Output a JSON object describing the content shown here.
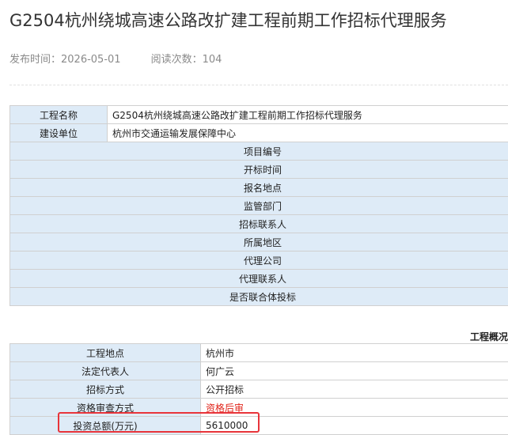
{
  "title": "G2504杭州绕城高速公路改扩建工程前期工作招标代理服务",
  "meta": {
    "publish_label": "发布时间：",
    "publish_date": "2026-05-01",
    "views_label": "阅读次数：",
    "views": "104"
  },
  "info_table": {
    "project_name_label": "工程名称",
    "project_name": "G2504杭州绕城高速公路改扩建工程前期工作招标代理服务",
    "builder_label": "建设单位",
    "builder": "杭州市交通运输发展保障中心",
    "rows": [
      "项目编号",
      "开标时间",
      "报名地点",
      "监管部门",
      "招标联系人",
      "所属地区",
      "代理公司",
      "代理联系人",
      "是否联合体投标"
    ]
  },
  "overview": {
    "section_title": "工程概况",
    "rows": [
      {
        "label": "工程地点",
        "value": "杭州市"
      },
      {
        "label": "法定代表人",
        "value": "何广云"
      },
      {
        "label": "招标方式",
        "value": "公开招标"
      },
      {
        "label": "资格审查方式",
        "value": "资格后审",
        "color": "#e1251b"
      },
      {
        "label": "投资总额(万元)",
        "value": "5610000"
      }
    ]
  },
  "colors": {
    "label_bg": "#deebf7",
    "highlight": "#e8343a"
  }
}
